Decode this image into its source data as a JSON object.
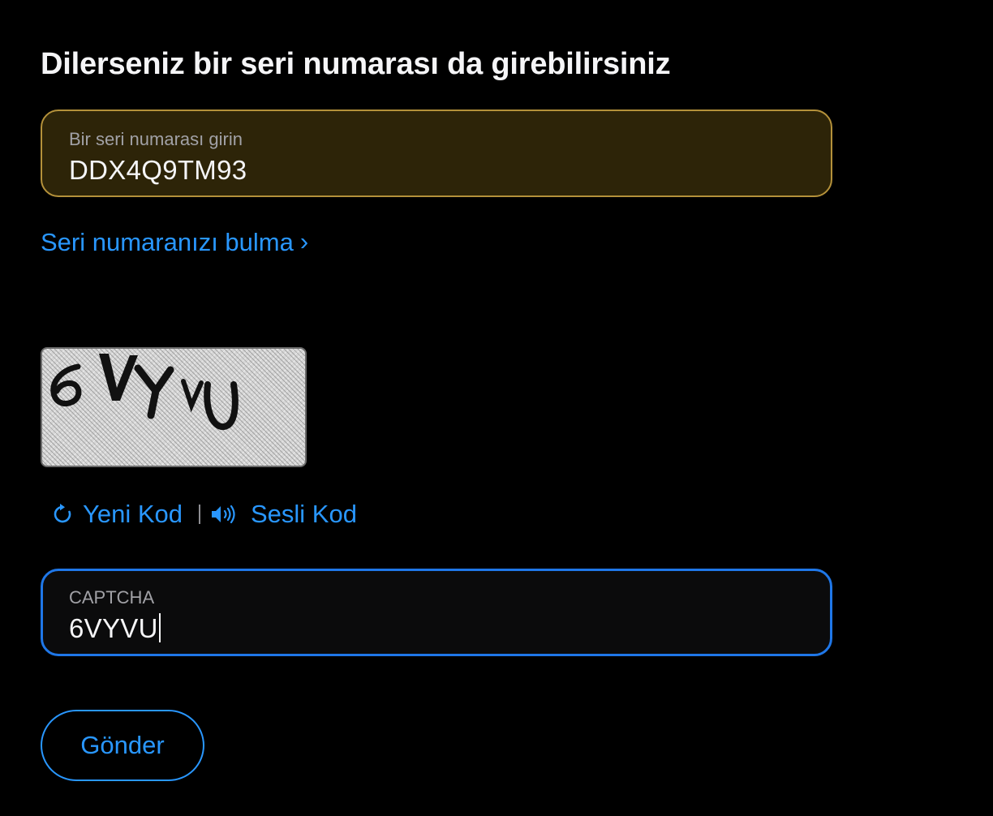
{
  "heading": "Dilerseniz bir seri numarası da girebilirsiniz",
  "serial_field": {
    "label": "Bir seri numarası girin",
    "value": "DDX4Q9TM93",
    "border_color": "#b4913a",
    "background_color": "#2d2408"
  },
  "find_serial_link": {
    "label": "Seri numaranızı bulma",
    "chevron": "›"
  },
  "captcha_image": {
    "text": "6VYVU"
  },
  "captcha_actions": {
    "new_code_label": "Yeni Kod",
    "new_code_icon": "refresh-icon",
    "audio_code_label": "Sesli Kod",
    "audio_code_icon": "speaker-icon"
  },
  "captcha_field": {
    "label": "CAPTCHA",
    "value": "6VYVU",
    "focus_color": "#1f77e8"
  },
  "submit_button": {
    "label": "Gönder"
  },
  "colors": {
    "accent": "#2997ff",
    "background": "#000000",
    "text": "#f5f5f7"
  }
}
